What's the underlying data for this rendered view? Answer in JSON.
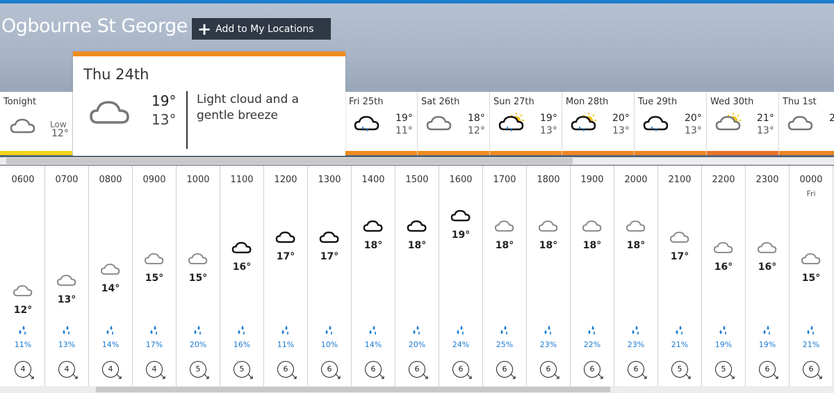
{
  "location": {
    "name": "Ogbourne St George",
    "add_button_label": "Add to My Locations"
  },
  "colors": {
    "accent_blue": "#1f7fcf",
    "today_bar": "#f08c1e",
    "precip_blue": "#1e7bd1",
    "add_button_bg": "#303846"
  },
  "tonight": {
    "label": "Tonight",
    "low_label": "Low",
    "low": "12°",
    "icon": "cloud-icon",
    "bar_color": "#f5d31b"
  },
  "today": {
    "date": "Thu 24th",
    "high": "19°",
    "low": "13°",
    "description": "Light cloud and a gentle breeze",
    "icon": "cloud-icon"
  },
  "days": [
    {
      "name": "Fri 25th",
      "high": "19°",
      "low": "11°",
      "icon": "cloud-rain-icon",
      "bar_color": "#f08c1e"
    },
    {
      "name": "Sat 26th",
      "high": "18°",
      "low": "12°",
      "icon": "cloud-icon",
      "bar_color": "#f08c1e"
    },
    {
      "name": "Sun 27th",
      "high": "19°",
      "low": "13°",
      "icon": "sun-cloud-rain-icon",
      "bar_color": "#f08c1e"
    },
    {
      "name": "Mon 28th",
      "high": "20°",
      "low": "13°",
      "icon": "sun-cloud-rain-icon",
      "bar_color": "#ee8523"
    },
    {
      "name": "Tue 29th",
      "high": "20°",
      "low": "13°",
      "icon": "cloud-rain-icon",
      "bar_color": "#ee8523"
    },
    {
      "name": "Wed 30th",
      "high": "21°",
      "low": "13°",
      "icon": "sun-cloud-icon",
      "bar_color": "#e8742a"
    },
    {
      "name": "Thu 1st",
      "high": "2",
      "low": "",
      "icon": "cloud-icon",
      "bar_color": "#ee8523"
    }
  ],
  "hours": [
    {
      "time": "0600",
      "day": "",
      "temp": "12°",
      "icon": "light-cloud-icon",
      "precip": "11%",
      "wind": "4"
    },
    {
      "time": "0700",
      "day": "",
      "temp": "13°",
      "icon": "light-cloud-icon",
      "precip": "13%",
      "wind": "4"
    },
    {
      "time": "0800",
      "day": "",
      "temp": "14°",
      "icon": "light-cloud-icon",
      "precip": "14%",
      "wind": "4"
    },
    {
      "time": "0900",
      "day": "",
      "temp": "15°",
      "icon": "light-cloud-icon",
      "precip": "17%",
      "wind": "4"
    },
    {
      "time": "1000",
      "day": "",
      "temp": "15°",
      "icon": "light-cloud-icon",
      "precip": "20%",
      "wind": "5"
    },
    {
      "time": "1100",
      "day": "",
      "temp": "16°",
      "icon": "cloud-icon",
      "precip": "16%",
      "wind": "5"
    },
    {
      "time": "1200",
      "day": "",
      "temp": "17°",
      "icon": "cloud-icon",
      "precip": "11%",
      "wind": "6"
    },
    {
      "time": "1300",
      "day": "",
      "temp": "17°",
      "icon": "cloud-icon",
      "precip": "10%",
      "wind": "6"
    },
    {
      "time": "1400",
      "day": "",
      "temp": "18°",
      "icon": "cloud-icon",
      "precip": "14%",
      "wind": "6"
    },
    {
      "time": "1500",
      "day": "",
      "temp": "18°",
      "icon": "cloud-icon",
      "precip": "20%",
      "wind": "6"
    },
    {
      "time": "1600",
      "day": "",
      "temp": "19°",
      "icon": "cloud-icon",
      "precip": "24%",
      "wind": "6"
    },
    {
      "time": "1700",
      "day": "",
      "temp": "18°",
      "icon": "light-cloud-icon",
      "precip": "25%",
      "wind": "6"
    },
    {
      "time": "1800",
      "day": "",
      "temp": "18°",
      "icon": "light-cloud-icon",
      "precip": "23%",
      "wind": "6"
    },
    {
      "time": "1900",
      "day": "",
      "temp": "18°",
      "icon": "light-cloud-icon",
      "precip": "22%",
      "wind": "6"
    },
    {
      "time": "2000",
      "day": "",
      "temp": "18°",
      "icon": "light-cloud-icon",
      "precip": "23%",
      "wind": "6"
    },
    {
      "time": "2100",
      "day": "",
      "temp": "17°",
      "icon": "light-cloud-icon",
      "precip": "21%",
      "wind": "5"
    },
    {
      "time": "2200",
      "day": "",
      "temp": "16°",
      "icon": "light-cloud-icon",
      "precip": "19%",
      "wind": "5"
    },
    {
      "time": "2300",
      "day": "",
      "temp": "16°",
      "icon": "light-cloud-icon",
      "precip": "19%",
      "wind": "6"
    },
    {
      "time": "0000",
      "day": "Fri",
      "temp": "15°",
      "icon": "light-cloud-icon",
      "precip": "21%",
      "wind": "6"
    }
  ]
}
